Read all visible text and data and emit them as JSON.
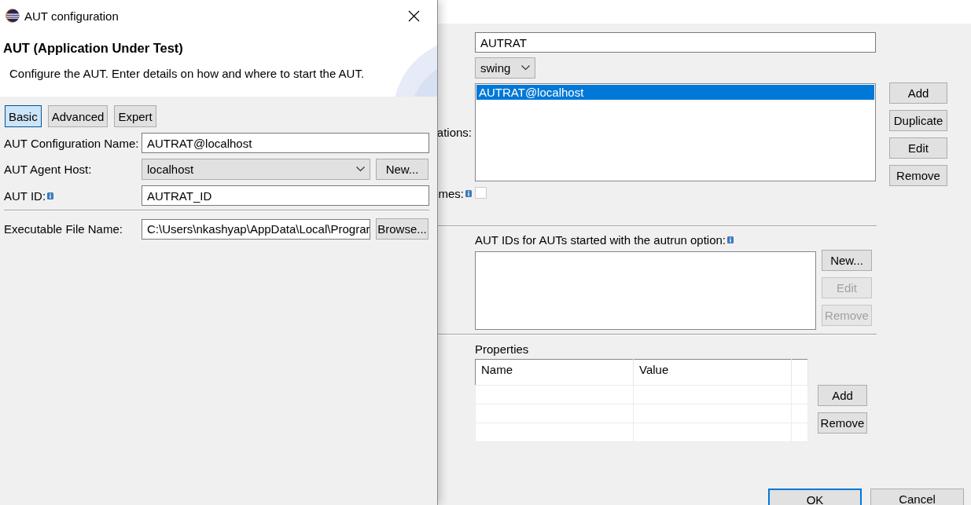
{
  "main_window": {
    "name_field": {
      "value": "AUTRAT"
    },
    "toolkit_combo": {
      "value": "swing"
    },
    "configurations": {
      "label": "ations:",
      "items": [
        {
          "label": "AUTRAT@localhost",
          "selected": true
        }
      ],
      "buttons": [
        {
          "label": "Add",
          "disabled": false
        },
        {
          "label": "Duplicate",
          "disabled": false
        },
        {
          "label": "Edit",
          "disabled": false
        },
        {
          "label": "Remove",
          "disabled": false
        }
      ]
    },
    "names_option": {
      "label": "mes:",
      "info": true,
      "checked": false
    },
    "autrun": {
      "label": "AUT IDs for AUTs started with the autrun option:",
      "info": true,
      "buttons": [
        {
          "label": "New...",
          "disabled": false
        },
        {
          "label": "Edit",
          "disabled": true
        },
        {
          "label": "Remove",
          "disabled": true
        }
      ]
    },
    "properties": {
      "label": "Properties",
      "columns": [
        "Name",
        "Value"
      ],
      "buttons": [
        {
          "label": "Add",
          "disabled": false
        },
        {
          "label": "Remove",
          "disabled": false
        }
      ]
    },
    "footer_buttons": [
      {
        "label": "OK",
        "default": true
      },
      {
        "label": "Cancel",
        "default": false
      }
    ]
  },
  "dialog": {
    "title": "AUT configuration",
    "heading": "AUT (Application Under Test)",
    "description": "Configure the AUT. Enter details on how and where to start the AUT.",
    "tabs": [
      {
        "label": "Basic",
        "selected": true
      },
      {
        "label": "Advanced",
        "selected": false
      },
      {
        "label": "Expert",
        "selected": false
      }
    ],
    "field_groups": [
      [
        {
          "kind": "text",
          "label": "AUT Configuration Name:",
          "info": false,
          "value": "AUTRAT@localhost"
        },
        {
          "kind": "combo",
          "label": "AUT Agent Host:",
          "info": false,
          "value": "localhost",
          "button": "New..."
        },
        {
          "kind": "text",
          "label": "AUT ID:",
          "info": true,
          "value": "AUTRAT_ID"
        }
      ],
      [
        {
          "kind": "file",
          "label": "Executable File Name:",
          "info": false,
          "value": "C:\\Users\\nkashyap\\AppData\\Local\\Prograr",
          "button": "Browse..."
        }
      ]
    ]
  }
}
